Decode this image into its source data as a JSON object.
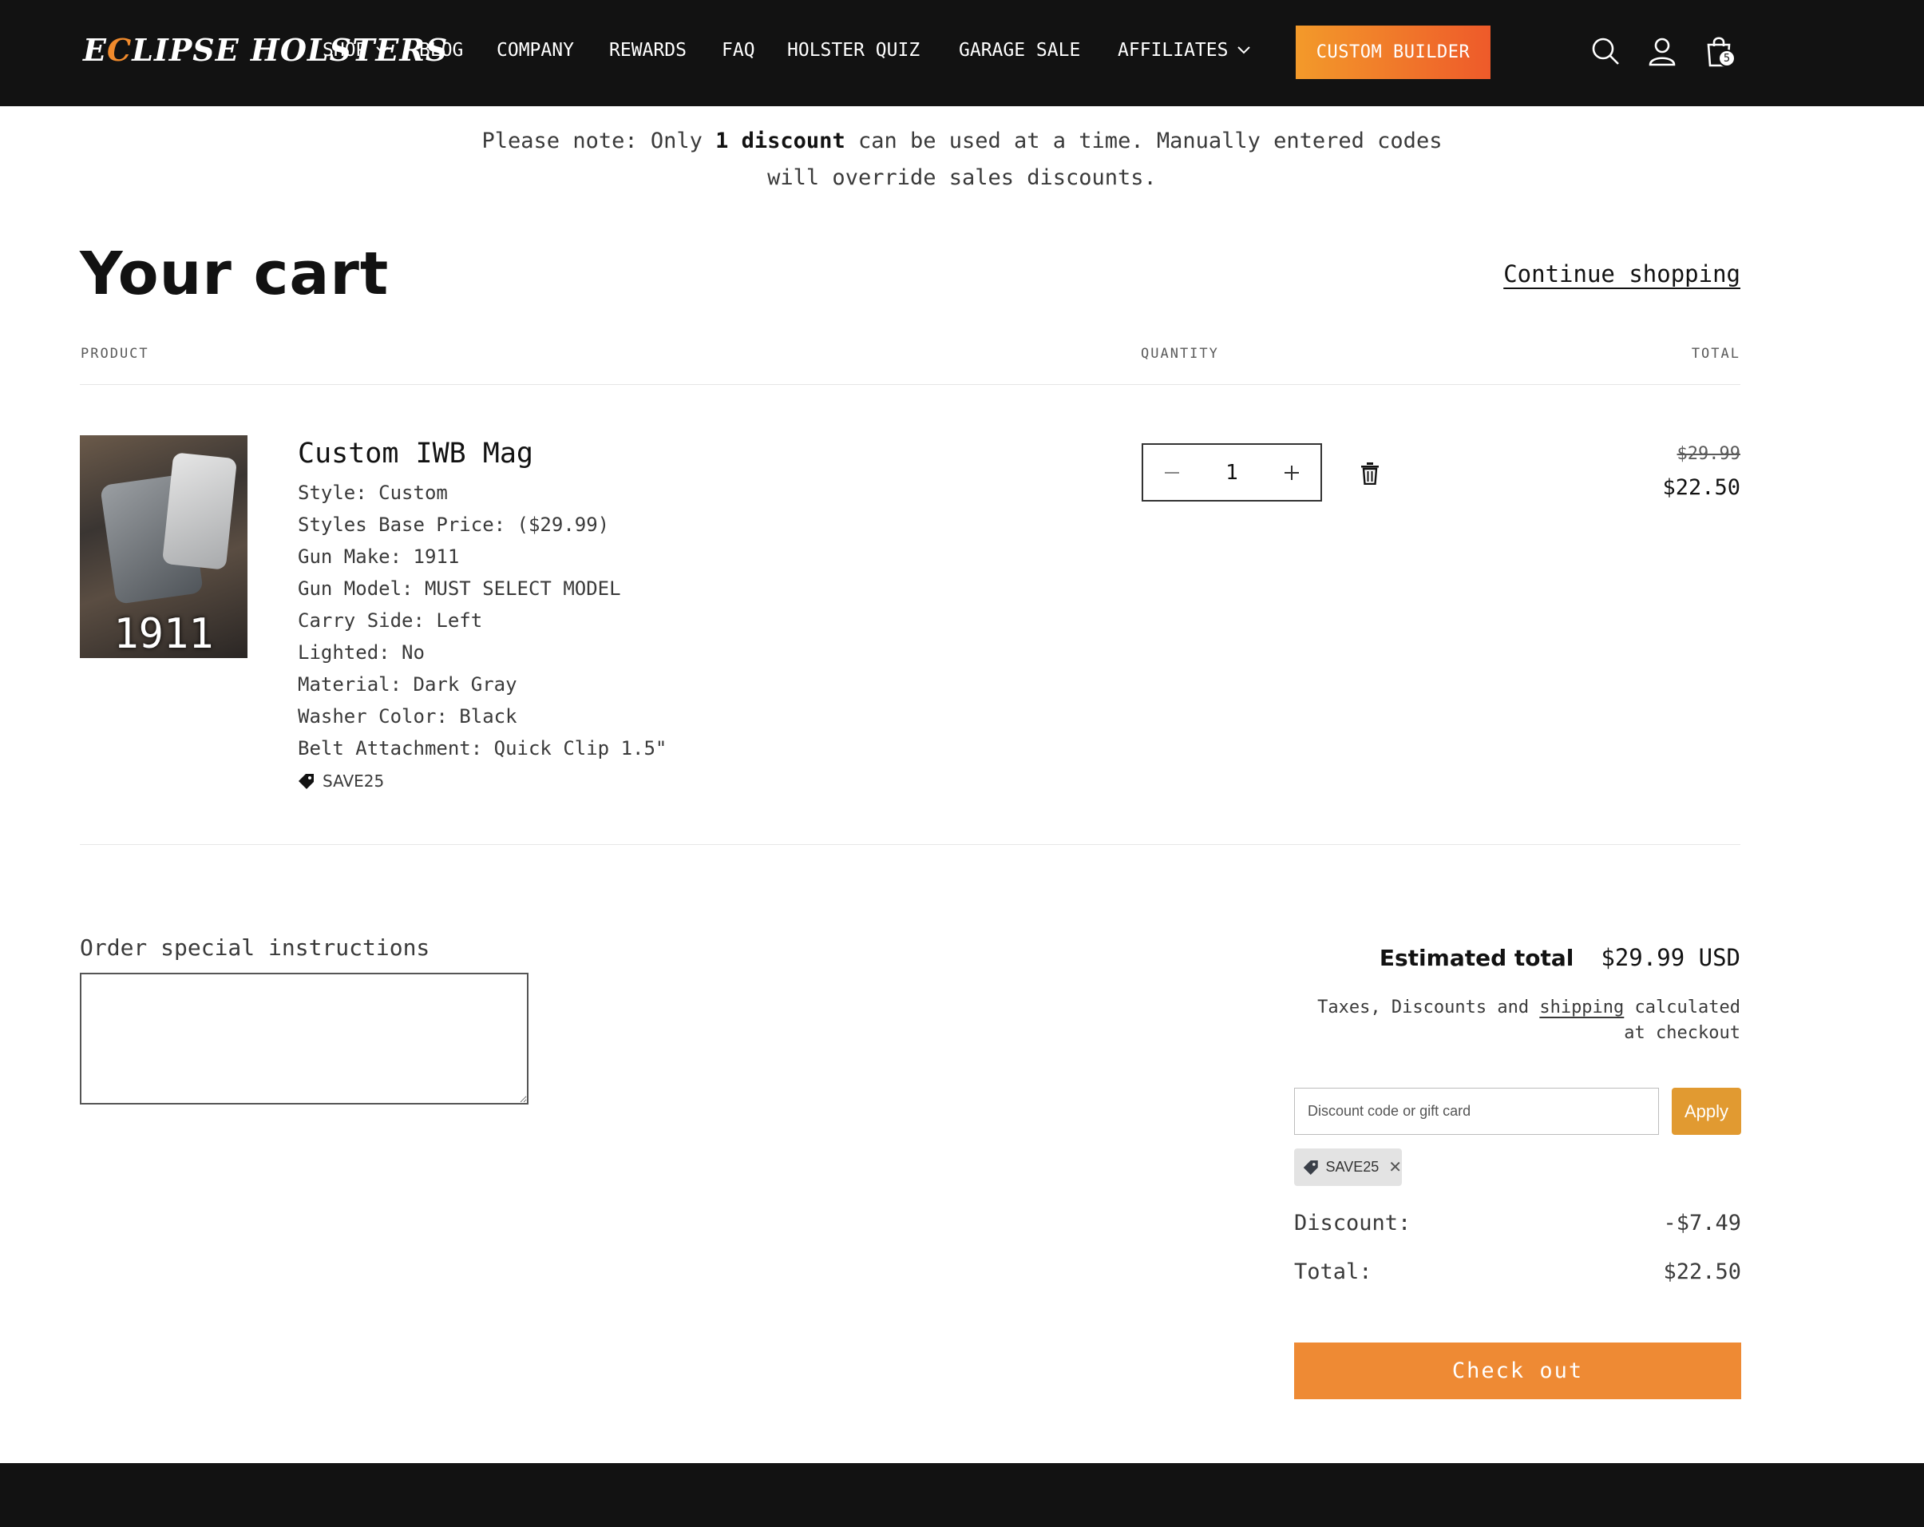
{
  "brand": {
    "logo_prefix": "E",
    "logo_accent": "C",
    "logo_rest": "LIPSE HOLSTERS"
  },
  "nav": {
    "items": [
      {
        "label": "SHOP"
      },
      {
        "label": "BLOG"
      },
      {
        "label": "COMPANY"
      },
      {
        "label": "REWARDS"
      },
      {
        "label": "FAQ"
      },
      {
        "label": "HOLSTER QUIZ"
      },
      {
        "label": "GARAGE SALE"
      },
      {
        "label": "AFFILIATES"
      }
    ],
    "builder_label": "CUSTOM BUILDER",
    "cart_count": "5"
  },
  "notice": {
    "before": "Please note: Only ",
    "bold": "1 discount",
    "after_line1": " can be used at a time. Manually entered codes",
    "line2": "will override sales discounts."
  },
  "cart": {
    "title": "Your cart",
    "continue_label": "Continue shopping",
    "columns": {
      "product": "PRODUCT",
      "quantity": "QUANTITY",
      "total": "TOTAL"
    }
  },
  "item": {
    "image_caption": "1911",
    "name": "Custom IWB Mag",
    "properties": [
      "Style: Custom",
      "Styles Base Price: ($29.99)",
      "Gun Make: 1911",
      "Gun Model: MUST SELECT MODEL",
      "Carry Side: Left",
      "Lighted: No",
      "Material: Dark Gray",
      "Washer Color: Black",
      "Belt Attachment: Quick Clip 1.5\""
    ],
    "discount_code": "SAVE25",
    "quantity": "1",
    "original_price": "$29.99",
    "final_price": "$22.50"
  },
  "instructions": {
    "label": "Order special instructions",
    "value": ""
  },
  "summary": {
    "estimated_label": "Estimated total",
    "estimated_value": "$29.99 USD",
    "tax_before": "Taxes, Discounts and ",
    "tax_link": "shipping",
    "tax_after": " calculated at checkout",
    "discount_placeholder": "Discount code or gift card",
    "apply_label": "Apply",
    "applied_code": "SAVE25",
    "discount_label": "Discount:",
    "discount_value": "-$7.49",
    "total_label": "Total:",
    "total_value": "$22.50",
    "checkout_label": "Check out"
  },
  "colors": {
    "accent": "#ee8a34",
    "header_bg": "#121212",
    "apply_bg": "#e19a31"
  }
}
